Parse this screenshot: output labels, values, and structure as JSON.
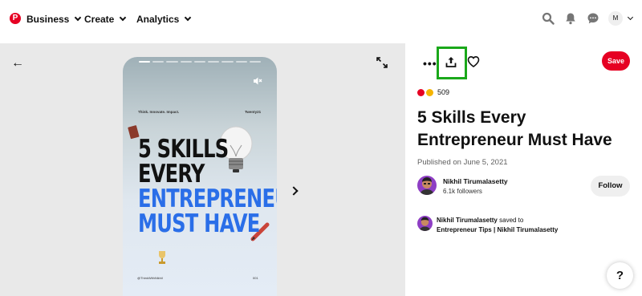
{
  "nav": {
    "business": "Business",
    "create": "Create",
    "analytics": "Analytics",
    "avatar_initial": "M",
    "logo_letter": "P"
  },
  "pin": {
    "card": {
      "tagline": "Think. Innovate. Impact.",
      "brand": "Twenty21",
      "headline": [
        "5 SKILLS",
        "EVERY",
        "ENTREPRENEUR",
        "MUST HAVE"
      ],
      "handle": "@ThinkWithNikhil",
      "page": "001",
      "story_pages_total": 9,
      "story_page_current": 1
    },
    "reaction_count": "509",
    "title": "5 Skills Every Entrepreneur Must Have",
    "published": "Published on June 5, 2021",
    "save_label": "Save"
  },
  "author": {
    "name": "Nikhil Tirumalasetty",
    "followers": "6.1k followers",
    "follow_label": "Follow"
  },
  "activity": {
    "user": "Nikhil Tirumalasetty",
    "action": " saved to",
    "board": "Entrepreneur Tips | Nikhil Tirumalasetty"
  },
  "help_label": "?",
  "colors": {
    "brand_red": "#e60023",
    "headline_blue": "#2a6ee8",
    "highlight_green": "#1aa81a"
  }
}
